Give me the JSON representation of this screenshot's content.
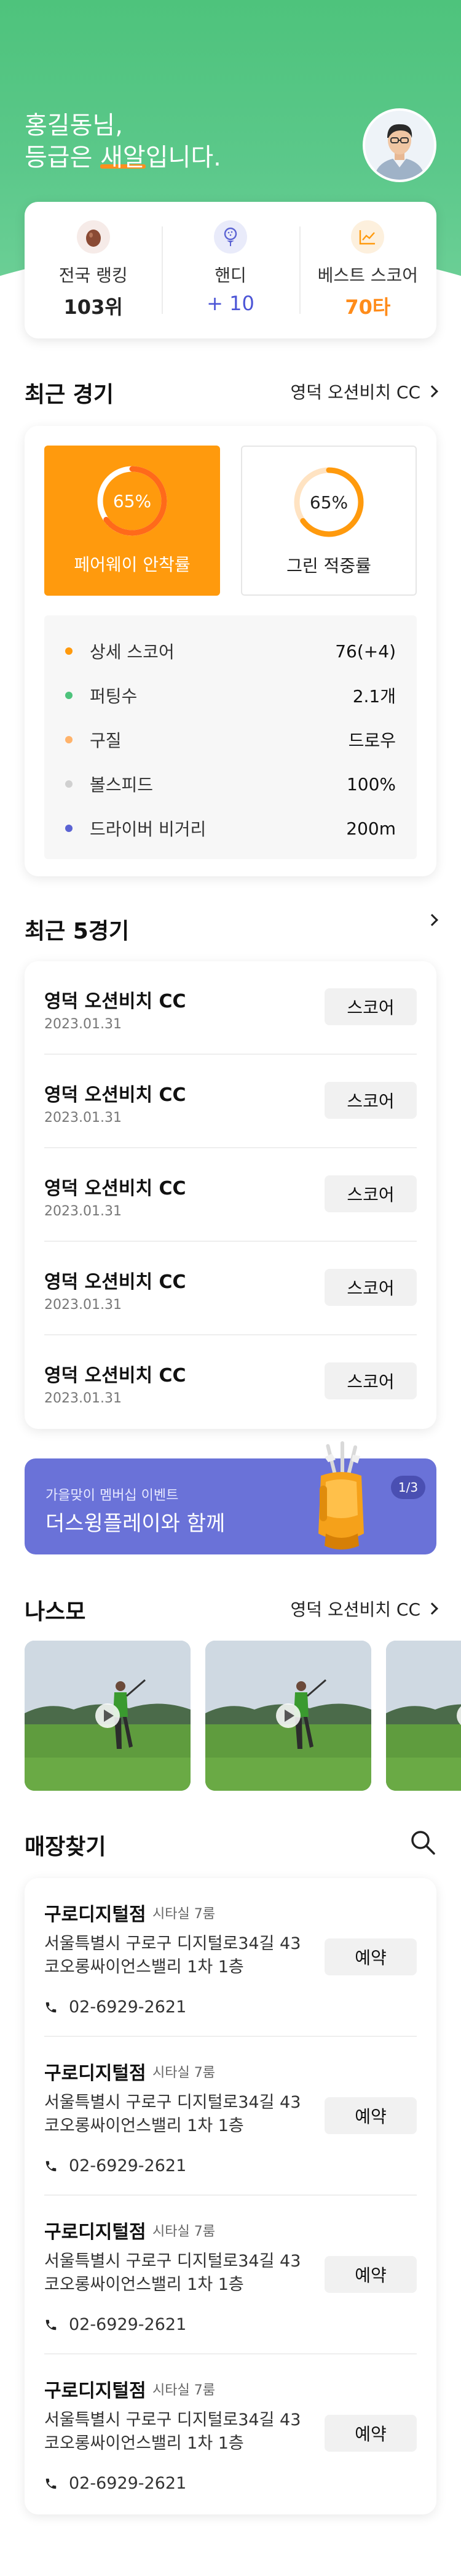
{
  "header": {
    "greeting_line1": "홍길동님,",
    "greeting_prefix": "등급은 ",
    "grade": "새알",
    "greeting_suffix": "입니다."
  },
  "stats": [
    {
      "icon": "egg-icon",
      "label": "전국 랭킹",
      "value": "103위"
    },
    {
      "icon": "golf-ball-tee-icon",
      "label": "핸디",
      "value": "+ 10"
    },
    {
      "icon": "chart-line-icon",
      "label": "베스트 스코어",
      "value": "70타"
    }
  ],
  "recent_round": {
    "title": "최근 경기",
    "course_link": "영덕 오션비치 CC",
    "fairway": {
      "percent": 65,
      "percent_label": "65%",
      "label": "페어웨이 안착률"
    },
    "green": {
      "percent": 65,
      "percent_label": "65%",
      "label": "그린 적중률"
    },
    "details": [
      {
        "label": "상세 스코어",
        "value": "76(+4)",
        "color": "#ff9a0d"
      },
      {
        "label": "퍼팅수",
        "value": "2.1개",
        "color": "#4ec37c"
      },
      {
        "label": "구질",
        "value": "드로우",
        "color": "#ffb36b"
      },
      {
        "label": "볼스피드",
        "value": "100%",
        "color": "#d0d0d0"
      },
      {
        "label": "드라이버 비거리",
        "value": "200m",
        "color": "#5b63d3"
      }
    ]
  },
  "last_rounds": {
    "title": "최근 5경기",
    "button_label": "스코어",
    "items": [
      {
        "name": "영덕 오션비치 CC",
        "date": "2023.01.31"
      },
      {
        "name": "영덕 오션비치 CC",
        "date": "2023.01.31"
      },
      {
        "name": "영덕 오션비치 CC",
        "date": "2023.01.31"
      },
      {
        "name": "영덕 오션비치 CC",
        "date": "2023.01.31"
      },
      {
        "name": "영덕 오션비치 CC",
        "date": "2023.01.31"
      }
    ]
  },
  "banner": {
    "subtitle": "가을맞이 멤버십 이벤트",
    "title": "더스윙플레이와 함께",
    "page_indicator": "1/3"
  },
  "videos": {
    "title": "나스모",
    "course_link": "영덕 오션비치 CC"
  },
  "stores": {
    "title": "매장찾기",
    "button_label": "예약",
    "items": [
      {
        "name": "구로디지털점",
        "tag": "시타실 7룸",
        "address": "서울특별시 구로구 디지털로34길 43 코오롱싸이언스밸리 1차 1층",
        "phone": "02-6929-2621"
      },
      {
        "name": "구로디지털점",
        "tag": "시타실 7룸",
        "address": "서울특별시 구로구 디지털로34길 43 코오롱싸이언스밸리 1차 1층",
        "phone": "02-6929-2621"
      },
      {
        "name": "구로디지털점",
        "tag": "시타실 7룸",
        "address": "서울특별시 구로구 디지털로34길 43 코오롱싸이언스밸리 1차 1층",
        "phone": "02-6929-2621"
      },
      {
        "name": "구로디지털점",
        "tag": "시타실 7룸",
        "address": "서울특별시 구로구 디지털로34길 43 코오롱싸이언스밸리 1차 1층",
        "phone": "02-6929-2621"
      }
    ]
  },
  "colors": {
    "brand_green": "#4ec37c",
    "accent_orange": "#ff9a0d",
    "accent_blue": "#5b63d3"
  }
}
